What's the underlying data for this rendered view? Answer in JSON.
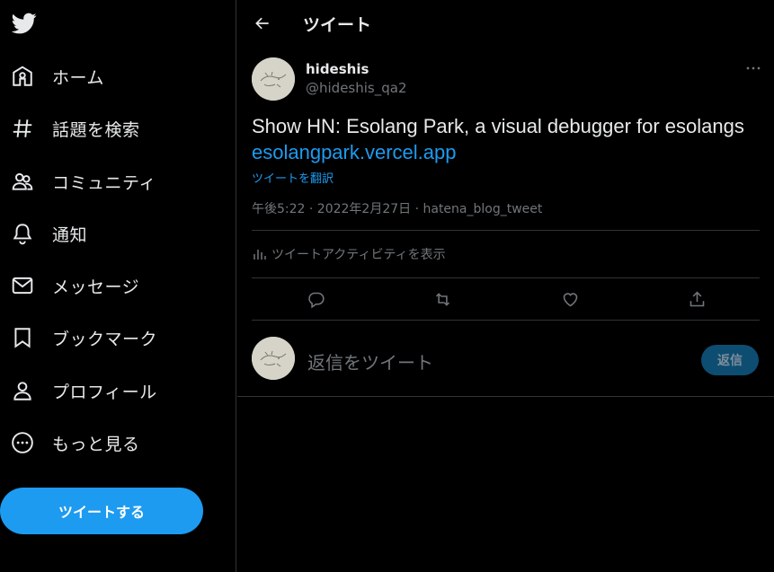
{
  "nav": {
    "items": [
      {
        "label": "ホーム",
        "icon": "home-icon"
      },
      {
        "label": "話題を検索",
        "icon": "hashtag-icon"
      },
      {
        "label": "コミュニティ",
        "icon": "communities-icon"
      },
      {
        "label": "通知",
        "icon": "bell-icon"
      },
      {
        "label": "メッセージ",
        "icon": "mail-icon"
      },
      {
        "label": "ブックマーク",
        "icon": "bookmark-icon"
      },
      {
        "label": "プロフィール",
        "icon": "profile-icon"
      },
      {
        "label": "もっと見る",
        "icon": "more-circle-icon"
      }
    ],
    "tweet_button": "ツイートする"
  },
  "header": {
    "title": "ツイート"
  },
  "tweet": {
    "author_name": "hideshis",
    "author_handle": "@hideshis_qa2",
    "text": "Show HN: Esolang Park, a visual debugger for esolangs",
    "link": "esolangpark.vercel.app",
    "translate": "ツイートを翻訳",
    "meta": "午後5:22 · 2022年2月27日 · hatena_blog_tweet",
    "activity": "ツイートアクティビティを表示"
  },
  "reply": {
    "placeholder": "返信をツイート",
    "button": "返信"
  },
  "colors": {
    "background": "#000000",
    "accent": "#1d9bf0",
    "muted": "#71767b",
    "border": "#2f3336"
  }
}
